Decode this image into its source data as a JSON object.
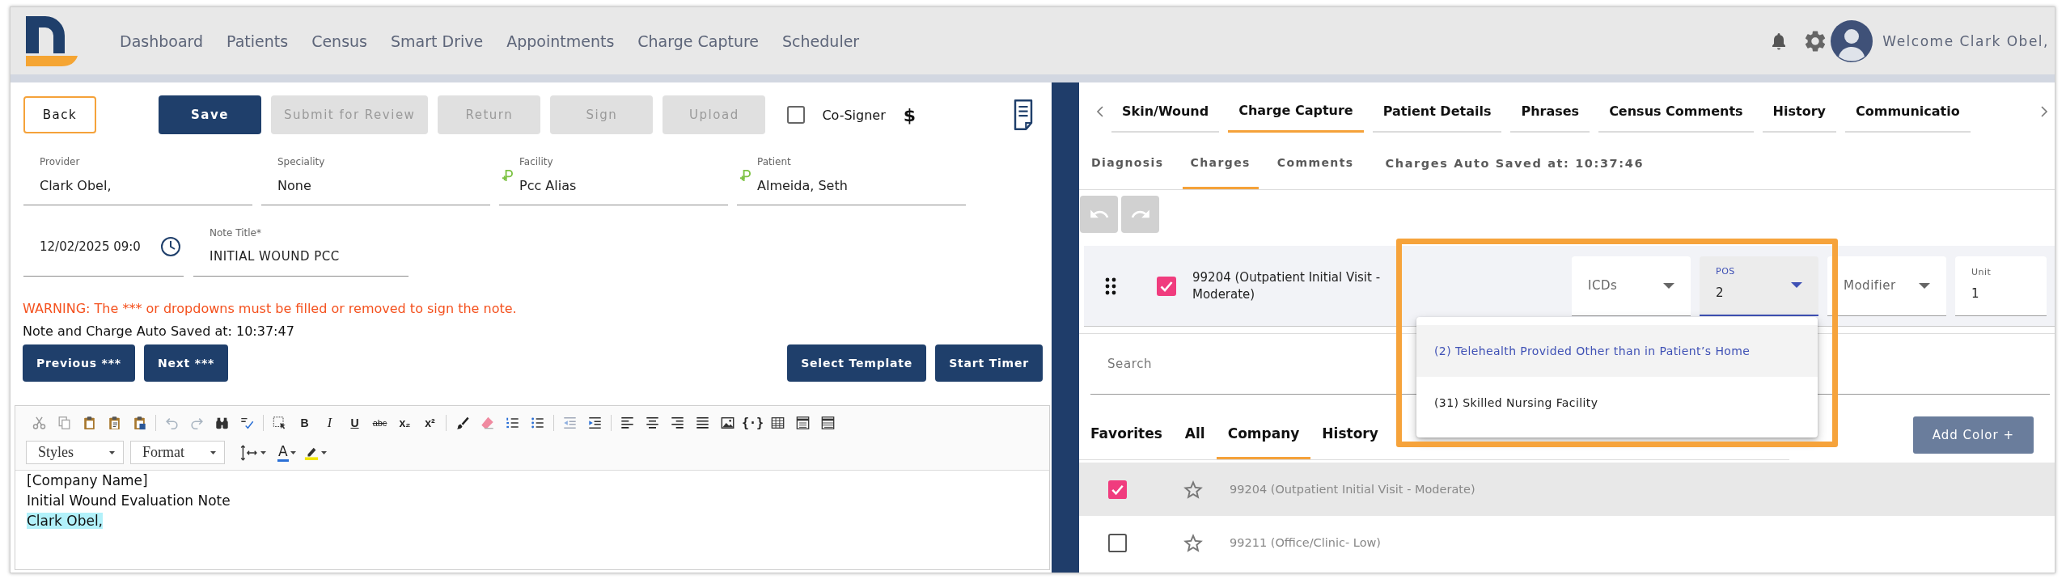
{
  "header": {
    "nav": [
      "Dashboard",
      "Patients",
      "Census",
      "Smart Drive",
      "Appointments",
      "Charge Capture",
      "Scheduler"
    ],
    "welcome": "Welcome Clark Obel,"
  },
  "note": {
    "back": "Back",
    "actions": [
      {
        "label": "Save",
        "disabled": false
      },
      {
        "label": "Submit for Review",
        "disabled": true
      },
      {
        "label": "Return",
        "disabled": true
      },
      {
        "label": "Sign",
        "disabled": true
      },
      {
        "label": "Upload",
        "disabled": true
      }
    ],
    "cosigner": {
      "label": "Co-Signer",
      "checked": false
    },
    "billing_symbol": "$",
    "fields": [
      {
        "label": "Provider",
        "value": "Clark Obel,",
        "linked": false
      },
      {
        "label": "Speciality",
        "value": "None",
        "linked": false
      },
      {
        "label": "Facility",
        "value": "Pcc Alias",
        "linked": true
      },
      {
        "label": "Patient",
        "value": "Almeida, Seth",
        "linked": true
      }
    ],
    "date": {
      "value": "12/02/2025 09:0"
    },
    "title": {
      "label": "Note Title*",
      "value": "INITIAL WOUND PCC"
    },
    "warning": "WARNING: The *** or dropdowns must be filled or removed to sign the note.",
    "autosave": "Note and Charge Auto Saved at: 10:37:47",
    "step_buttons": [
      "Previous ***",
      "Next ***"
    ],
    "tool_buttons": [
      "Select Template",
      "Start Timer"
    ],
    "editor": {
      "format_buttons": [
        {
          "kind": "bold",
          "label": "B"
        },
        {
          "kind": "italic",
          "label": "I"
        },
        {
          "kind": "underline",
          "label": "U"
        },
        {
          "kind": "strike",
          "label": "abc"
        },
        {
          "kind": "sub",
          "label": "x₂"
        },
        {
          "kind": "sup",
          "label": "x²"
        }
      ],
      "placeholder_button": "{·}",
      "styles": "Styles",
      "format": "Format",
      "text_color": "A",
      "lines": [
        {
          "text": "[Company Name]",
          "highlighted": false
        },
        {
          "text": "Initial Wound Evaluation Note",
          "highlighted": false
        },
        {
          "text": "Clark Obel,",
          "highlighted": true
        }
      ]
    }
  },
  "charges": {
    "tabs": [
      {
        "label": "Skin/Wound",
        "selected": false
      },
      {
        "label": "Charge Capture",
        "selected": true
      },
      {
        "label": "Patient Details",
        "selected": false
      },
      {
        "label": "Phrases",
        "selected": false
      },
      {
        "label": "Census Comments",
        "selected": false
      },
      {
        "label": "History",
        "selected": false
      },
      {
        "label": "Communicatio",
        "selected": false
      }
    ],
    "subtabs": [
      {
        "label": "Diagnosis",
        "selected": false
      },
      {
        "label": "Charges",
        "selected": true
      },
      {
        "label": "Comments",
        "selected": false
      }
    ],
    "autosave": "Charges Auto Saved at: 10:37:46",
    "current": {
      "checked": true,
      "code": "99204 (Outpatient Initial Visit - Moderate)",
      "inputs": [
        {
          "kind": "select",
          "label": "ICDs",
          "focused": false
        },
        {
          "kind": "select",
          "label": "POS",
          "value": "2",
          "focused": true
        },
        {
          "kind": "select",
          "label": "Modifier",
          "focused": false
        },
        {
          "kind": "input",
          "label": "Unit",
          "value": "1",
          "focused": false
        }
      ]
    },
    "pos_options": [
      {
        "label": "(2) Telehealth Provided Other than in Patient’s Home",
        "selected": true
      },
      {
        "label": "(31) Skilled Nursing Facility",
        "selected": false
      }
    ],
    "search": {
      "placeholder": "Search"
    },
    "code_tabs": [
      {
        "label": "Favorites",
        "selected": false
      },
      {
        "label": "All",
        "selected": false
      },
      {
        "label": "Company",
        "selected": true
      },
      {
        "label": "History",
        "selected": false
      }
    ],
    "add_color": "Add Color +",
    "rows": [
      {
        "selected": true,
        "checked": true,
        "starred": false,
        "code": "99204 (Outpatient Initial Visit - Moderate)"
      },
      {
        "selected": false,
        "checked": false,
        "starred": false,
        "code": "99211 (Office/Clinic- Low)"
      }
    ]
  }
}
